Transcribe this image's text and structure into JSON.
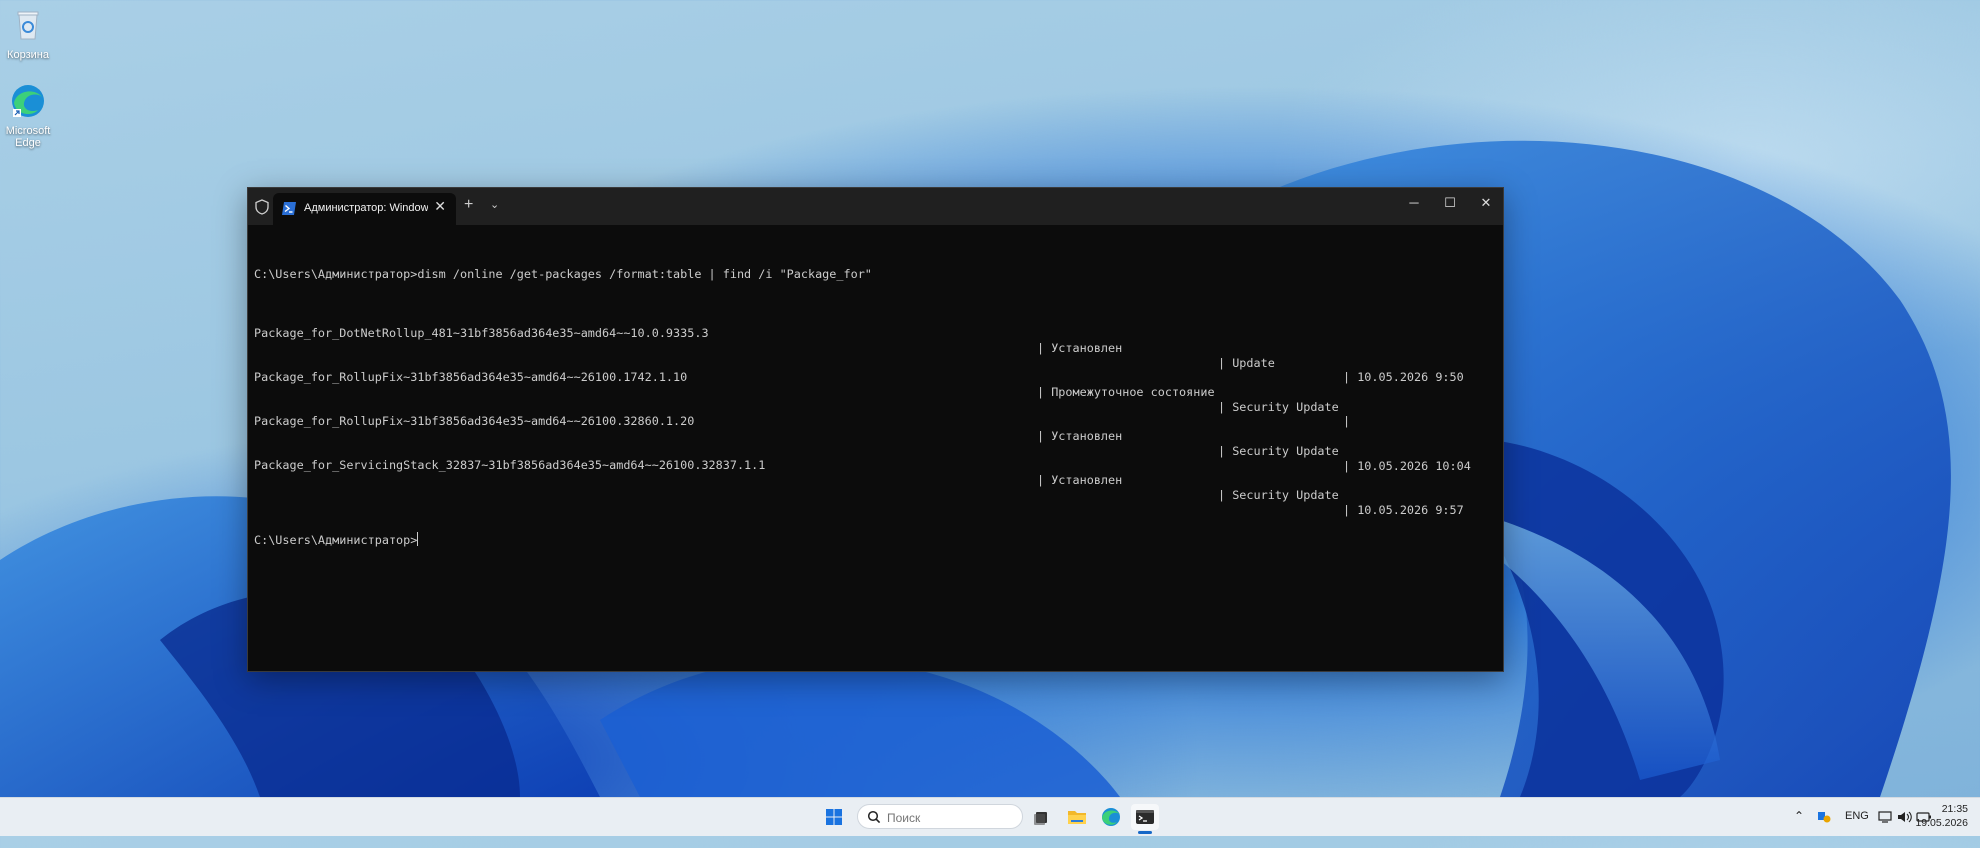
{
  "desktop": {
    "icons": [
      {
        "label": "Корзина",
        "icon": "recycle-bin-icon"
      },
      {
        "label": "Microsoft Edge",
        "icon": "edge-icon"
      }
    ]
  },
  "terminal": {
    "tab_title": "Администратор: Windows Po",
    "tab_close": "✕",
    "new_tab": "+",
    "dropdown": "⌄",
    "window_buttons": {
      "minimize": "─",
      "maximize": "☐",
      "close": "✕"
    },
    "command_line": "C:\\Users\\Администратор>dism /online /get-packages /format:table | find /i \"Package_for\"",
    "rows": [
      {
        "name": "Package_for_DotNetRollup_481~31bf3856ad364e35~amd64~~10.0.9335.3",
        "state": "| Установлен",
        "type": "| Update",
        "date": "| 10.05.2026 9:50"
      },
      {
        "name": "Package_for_RollupFix~31bf3856ad364e35~amd64~~26100.1742.1.10",
        "state": "| Промежуточное состояние",
        "type": "| Security Update",
        "date": "|"
      },
      {
        "name": "Package_for_RollupFix~31bf3856ad364e35~amd64~~26100.32860.1.20",
        "state": "| Установлен",
        "type": "| Security Update",
        "date": "| 10.05.2026 10:04"
      },
      {
        "name": "Package_for_ServicingStack_32837~31bf3856ad364e35~amd64~~26100.32837.1.1",
        "state": "| Установлен",
        "type": "| Security Update",
        "date": "| 10.05.2026 9:57"
      }
    ],
    "prompt": "C:\\Users\\Администратор>"
  },
  "taskbar": {
    "search_placeholder": "Поиск",
    "apps": [
      "start-icon",
      "task-view-icon",
      "file-explorer-icon",
      "edge-icon",
      "terminal-icon"
    ],
    "tray": {
      "language": "ENG",
      "time": "21:35",
      "date": "19.05.2026"
    }
  },
  "colors": {
    "terminal_bg": "#0c0c0c",
    "terminal_text": "#cccccc",
    "titlebar_bg": "#202020",
    "taskbar_bg": "#e9eef3",
    "accent": "#1668c7"
  }
}
